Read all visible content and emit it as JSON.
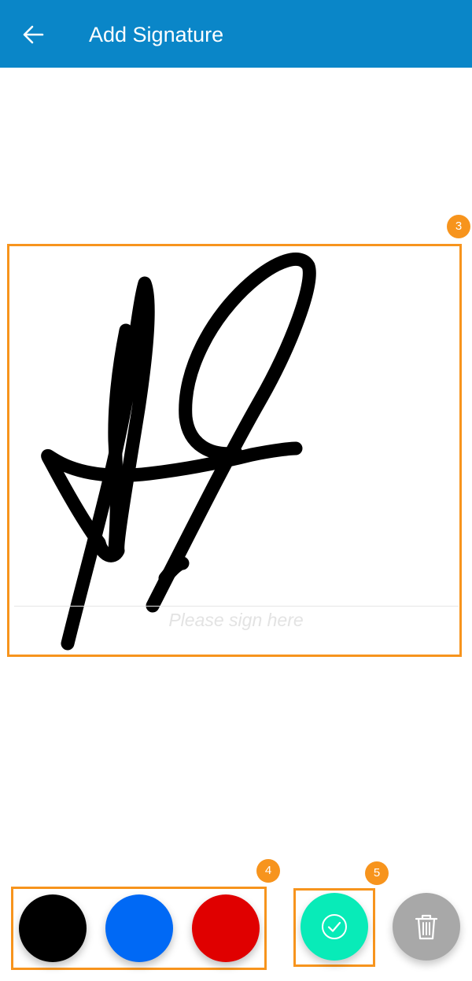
{
  "header": {
    "title": "Add Signature",
    "back_icon": "arrow-left-icon",
    "background": "#0a86c8"
  },
  "signature_pad": {
    "placeholder": "Please sign here",
    "stroke_color": "#000000"
  },
  "callouts": {
    "pad": "3",
    "colors": "4",
    "confirm": "5"
  },
  "pen_colors": [
    {
      "name": "black",
      "hex": "#000000"
    },
    {
      "name": "blue",
      "hex": "#0069f5"
    },
    {
      "name": "red",
      "hex": "#e00000"
    }
  ],
  "actions": {
    "confirm": {
      "icon": "check-circle-icon",
      "color": "#08ebb8"
    },
    "delete": {
      "icon": "trash-icon",
      "color": "#a8a8a8"
    }
  },
  "highlight_color": "#f7941d"
}
